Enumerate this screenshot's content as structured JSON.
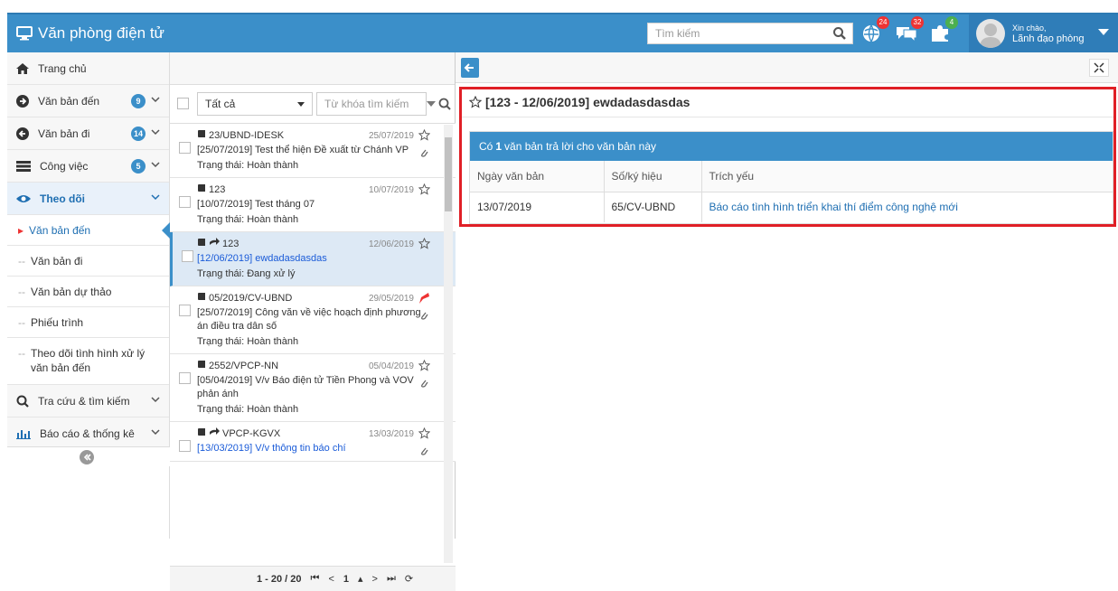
{
  "header": {
    "title": "Văn phòng điện tử",
    "search_placeholder": "Tìm kiếm",
    "notifications": [
      {
        "icon": "globe-icon",
        "count": "24"
      },
      {
        "icon": "chat-icon",
        "count": "32"
      },
      {
        "icon": "puzzle-icon",
        "count": "4"
      }
    ],
    "user": {
      "greeting": "Xin chào,",
      "name": "Lãnh đạo phòng"
    }
  },
  "sidebar": {
    "items": [
      {
        "label": "Trang chủ",
        "icon": "home-icon"
      },
      {
        "label": "Văn bản đến",
        "icon": "arrow-circle-right-icon",
        "count": "9"
      },
      {
        "label": "Văn bản đi",
        "icon": "arrow-circle-left-icon",
        "count": "14"
      },
      {
        "label": "Công việc",
        "icon": "tasks-icon",
        "count": "5"
      },
      {
        "label": "Theo dõi",
        "icon": "eye-icon"
      }
    ],
    "sub_items": [
      {
        "label": "Văn bản đến"
      },
      {
        "label": "Văn bản đi"
      },
      {
        "label": "Văn bản dự thảo"
      },
      {
        "label": "Phiếu trình"
      },
      {
        "label": "Theo dõi tình hình xử lý văn bản đến"
      }
    ],
    "bottom_items": [
      {
        "label": "Tra cứu & tìm kiếm",
        "icon": "search-icon"
      },
      {
        "label": "Báo cáo & thống kê",
        "icon": "bar-chart-icon"
      }
    ]
  },
  "list": {
    "filter_value": "Tất cả",
    "keyword_placeholder": "Từ khóa tìm kiếm",
    "items": [
      {
        "number": "23/UBND-IDESK",
        "date": "25/07/2019",
        "title": "[25/07/2019] Test thể hiện Đề xuất từ Chánh VP",
        "status": "Trạng thái: Hoàn thành",
        "reply": false,
        "clip": true,
        "flag": false
      },
      {
        "number": "123",
        "date": "10/07/2019",
        "title": "[10/07/2019] Test tháng 07",
        "status": "Trạng thái: Hoàn thành",
        "reply": false,
        "clip": false,
        "flag": false
      },
      {
        "number": "123",
        "date": "12/06/2019",
        "title": "[12/06/2019] ewdadasdasdas",
        "status": "Trạng thái: Đang xử lý",
        "reply": true,
        "clip": false,
        "flag": false
      },
      {
        "number": "05/2019/CV-UBND",
        "date": "29/05/2019",
        "title": "[25/07/2019] Công văn về việc hoạch định phương án điều tra dân số",
        "status": "Trạng thái: Hoàn thành",
        "reply": false,
        "clip": true,
        "flag": true
      },
      {
        "number": "2552/VPCP-NN",
        "date": "05/04/2019",
        "title": "[05/04/2019] V/v Báo điện tử Tiền Phong và VOV phản ánh",
        "status": "Trạng thái: Hoàn thành",
        "reply": false,
        "clip": true,
        "flag": false
      },
      {
        "number": "VPCP-KGVX",
        "date": "13/03/2019",
        "title": "[13/03/2019] V/v thông tin báo chí",
        "status": "",
        "reply": true,
        "clip": true,
        "flag": false
      }
    ],
    "pager": {
      "range": "1 - 20 / 20",
      "page": "1"
    }
  },
  "detail": {
    "title": "[123 - 12/06/2019] ewdadasdasdas",
    "response_prefix": "Có",
    "response_count": "1",
    "response_suffix": "văn bản trả lời cho văn bản này",
    "columns": [
      "Ngày văn bản",
      "Số/ký hiệu",
      "Trích yếu"
    ],
    "rows": [
      {
        "date": "13/07/2019",
        "number": "65/CV-UBND",
        "summary": "Báo cáo tình hình triển khai thí điểm công nghệ mới"
      }
    ]
  },
  "colors": {
    "primary": "#3b8fc9",
    "highlight_frame": "#e01f26",
    "link": "#1f6fb2"
  }
}
